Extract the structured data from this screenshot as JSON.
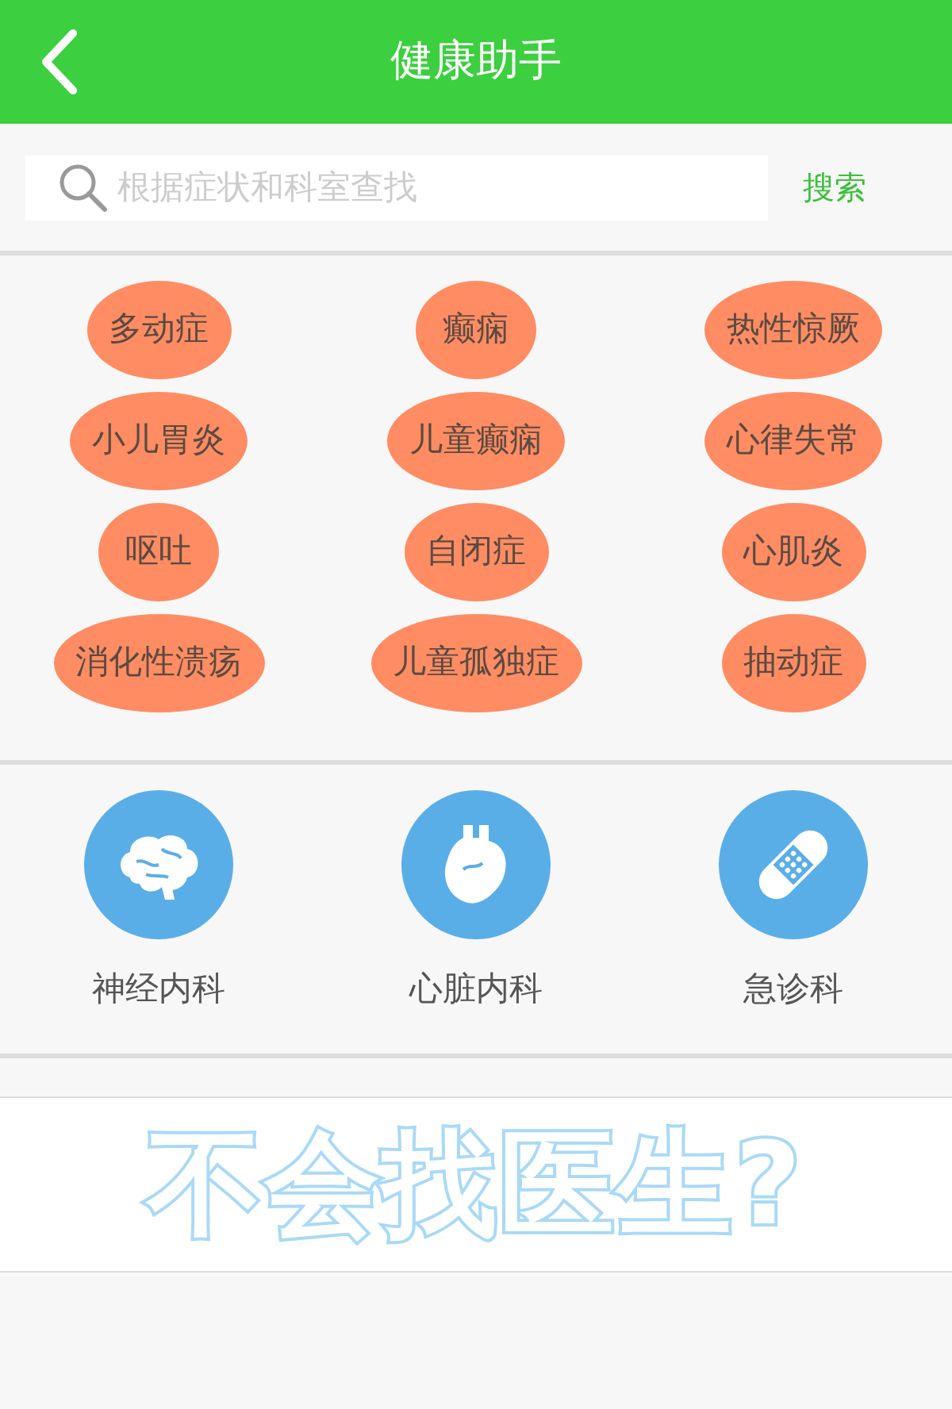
{
  "header": {
    "title": "健康助手"
  },
  "search": {
    "placeholder": "根据症状和科室查找",
    "button": "搜索"
  },
  "symptoms": [
    "多动症",
    "癫痫",
    "热性惊厥",
    "小儿胃炎",
    "儿童癫痫",
    "心律失常",
    "呕吐",
    "自闭症",
    "心肌炎",
    "消化性溃疡",
    "儿童孤独症",
    "抽动症"
  ],
  "departments": [
    {
      "label": "神经内科",
      "kind": "brain"
    },
    {
      "label": "心脏内科",
      "kind": "heart"
    },
    {
      "label": "急诊科",
      "kind": "bandage"
    }
  ],
  "banner": {
    "text": "不会找医生?"
  }
}
